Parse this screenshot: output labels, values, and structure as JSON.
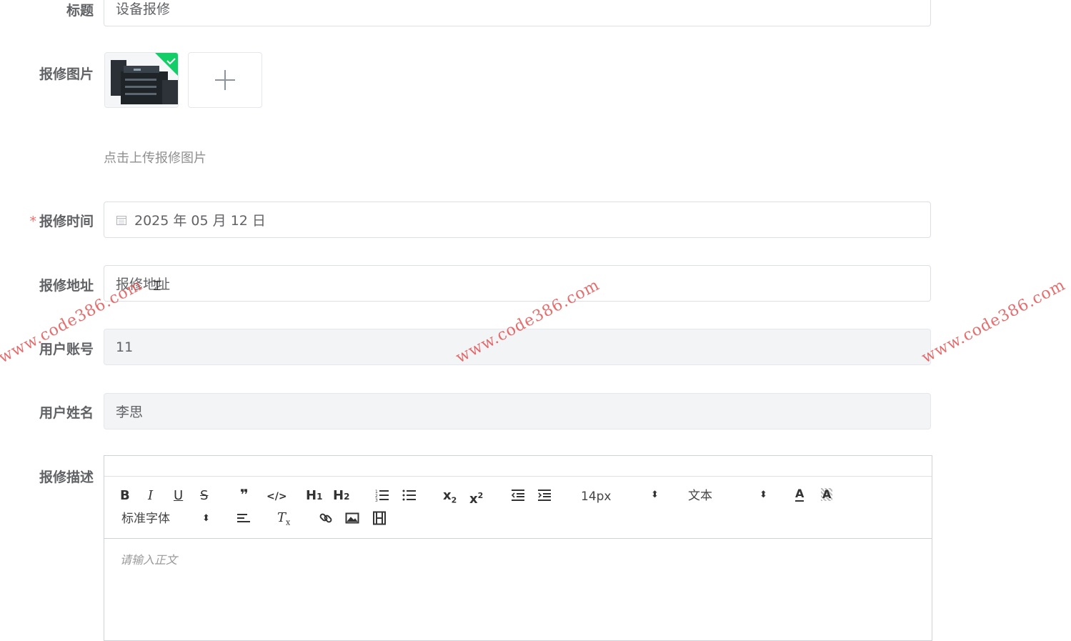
{
  "form": {
    "title_label": "标题",
    "title_value": "设备报修",
    "image_label": "报修图片",
    "image_tip": "点击上传报修图片",
    "required_mark": "*",
    "time_label": "报修时间",
    "time_value": "2025 年 05 月 12 日",
    "address_label": "报修地址",
    "address_placeholder": "报修地址",
    "account_label": "用户账号",
    "account_value": "11",
    "name_label": "用户姓名",
    "name_value": "李思",
    "desc_label": "报修描述"
  },
  "editor": {
    "font_size": "14px",
    "header_select": "文本",
    "font_family": "标准字体",
    "placeholder": "请输入正文"
  },
  "watermark": {
    "text": "www.code386.com"
  },
  "colors": {
    "required": "#f56c6c",
    "success_corner": "#13ce66",
    "disabled_bg": "#f3f4f6"
  }
}
